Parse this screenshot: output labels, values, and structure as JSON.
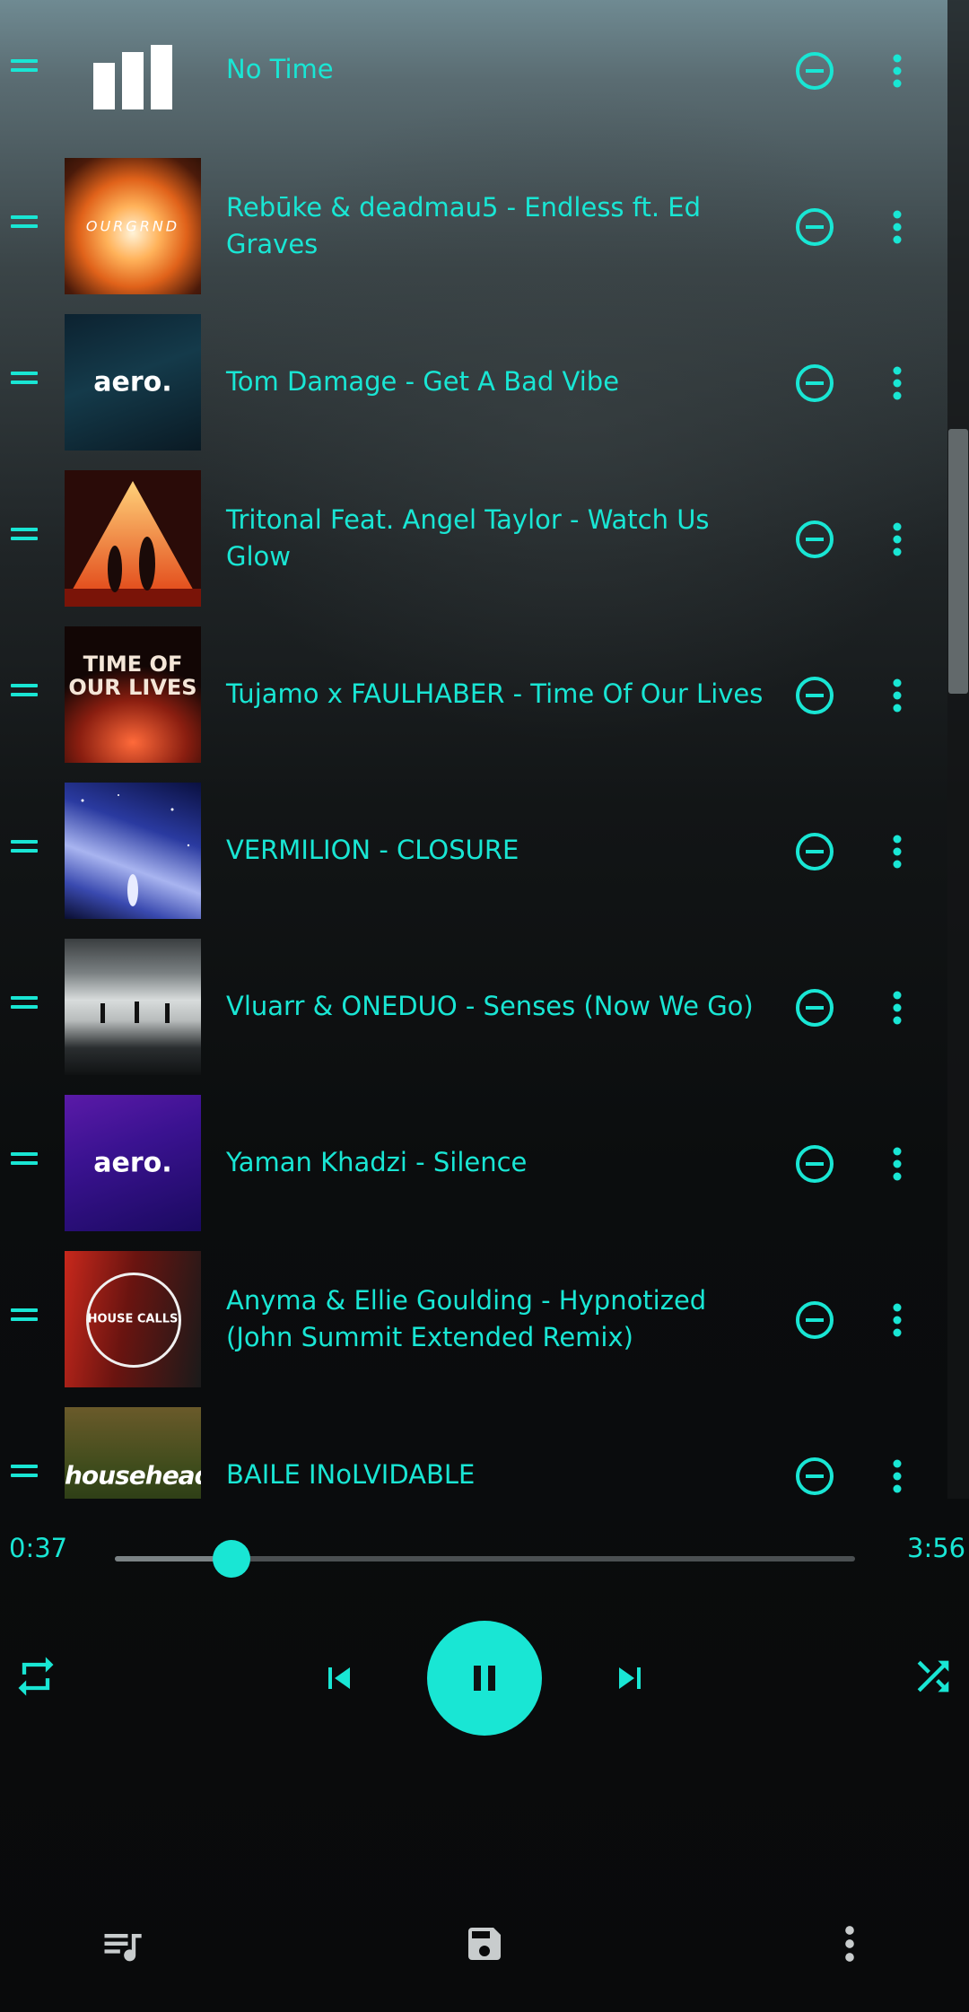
{
  "queue": [
    {
      "title": "No Time",
      "art": "now-playing-bars",
      "artLabel": ""
    },
    {
      "title": "Rebūke & deadmau5 - Endless ft. Ed Graves",
      "art": "orange-burst",
      "artLabel": "OURGRND"
    },
    {
      "title": "Tom Damage - Get A Bad Vibe",
      "art": "blue-portrait",
      "artLabel": "aero."
    },
    {
      "title": "Tritonal Feat. Angel Taylor - Watch Us Glow",
      "art": "triangle-dancers",
      "artLabel": ""
    },
    {
      "title": "Tujamo x FAULHABER - Time Of Our Lives",
      "art": "crowd-poster",
      "artLabel": "TIME OF OUR LIVES"
    },
    {
      "title": "VERMILION - CLOSURE",
      "art": "night-sky",
      "artLabel": ""
    },
    {
      "title": "Vluarr & ONEDUO - Senses (Now We Go)",
      "art": "lake-figures",
      "artLabel": ""
    },
    {
      "title": "Yaman Khadzi - Silence",
      "art": "purple-portrait",
      "artLabel": "aero."
    },
    {
      "title": "Anyma & Ellie Goulding - Hypnotized (John Summit Extended Remix)",
      "art": "house-calls",
      "artLabel": "HOUSE CALLS"
    },
    {
      "title": "BAILE INoLVIDABLE",
      "art": "househead",
      "artLabel": "househead"
    }
  ],
  "player": {
    "elapsed": "0:37",
    "duration": "3:56",
    "progress": 0.157,
    "state": "playing"
  },
  "icons": {
    "drag": "drag-handle-icon",
    "remove": "remove-circle-icon",
    "more": "more-vert-icon",
    "repeat": "repeat-icon",
    "previous": "skip-previous-icon",
    "pause": "pause-icon",
    "next": "skip-next-icon",
    "shuffle": "shuffle-icon",
    "queue": "queue-music-icon",
    "save": "save-icon",
    "overflow": "more-vert-icon"
  },
  "colors": {
    "accent": "#19e6d4",
    "buttonIcon": "#0e1213",
    "bottomBarIcon": "#c8cccd"
  }
}
